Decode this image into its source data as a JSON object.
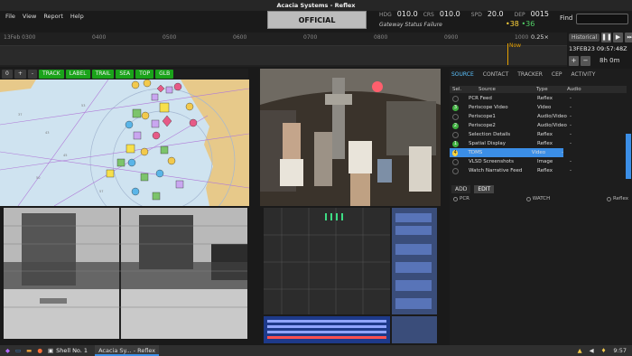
{
  "window_title": "Acacia Systems - Reflex",
  "menu": [
    "File",
    "View",
    "Report",
    "Help"
  ],
  "classification": "OFFICIAL",
  "nav": {
    "hdg_label": "HDG",
    "hdg": "010.0",
    "crs_label": "CRS",
    "crs": "010.0",
    "spd_label": "SPD",
    "spd": "20.0",
    "dep_label": "DEP",
    "dep": "0015"
  },
  "gateway_status": "Gateway Status Failure",
  "counters": {
    "yellow": "38",
    "green": "36"
  },
  "find_label": "Find",
  "timeline": {
    "ticks": [
      "13Feb 0300",
      "0400",
      "0500",
      "0600",
      "0700",
      "0800",
      "0900",
      "1000"
    ],
    "now_label": "Now",
    "zoom": "0.25×",
    "historical_label": "Historical",
    "datetime": "13FEB23 09:57:48Z",
    "duration": "8h 0m"
  },
  "map_toolbar": {
    "buttons": [
      "0",
      "+",
      "-"
    ],
    "layers": [
      "TRACK",
      "LABEL",
      "TRAIL",
      "SEA",
      "TOP",
      "GLB"
    ]
  },
  "panel": {
    "tabs": [
      "SOURCE",
      "CONTACT",
      "TRACKER",
      "CEP",
      "ACTIVITY"
    ],
    "columns": [
      "Sel.",
      "Source",
      "Type",
      "Audio"
    ],
    "rows": [
      {
        "sel": "",
        "source": "PCR Feed",
        "type": "Reflex",
        "audio": "-"
      },
      {
        "sel": "3",
        "source": "Periscope Video",
        "type": "Video",
        "audio": "-"
      },
      {
        "sel": "",
        "source": "Periscope1",
        "type": "Audio/Video",
        "audio": "-"
      },
      {
        "sel": "2",
        "source": "Periscope2",
        "type": "Audio/Video",
        "audio": "-"
      },
      {
        "sel": "",
        "source": "Selection Details",
        "type": "Reflex",
        "audio": "-"
      },
      {
        "sel": "1",
        "source": "Spatial Display",
        "type": "Reflex",
        "audio": "-"
      },
      {
        "sel": "4",
        "source": "TDMS",
        "type": "Video",
        "audio": "-"
      },
      {
        "sel": "",
        "source": "VLSD Screenshots",
        "type": "Image",
        "audio": "-"
      },
      {
        "sel": "",
        "source": "Watch Narrative Feed",
        "type": "Reflex",
        "audio": "-"
      }
    ],
    "add_label": "ADD",
    "edit_label": "EDIT",
    "radio_options": [
      "PCR",
      "WATCH",
      "Reflex"
    ]
  },
  "taskbar": {
    "shell": "Shell No. 1",
    "window": "Acacia Sy... - Reflex",
    "time": "9:57"
  }
}
